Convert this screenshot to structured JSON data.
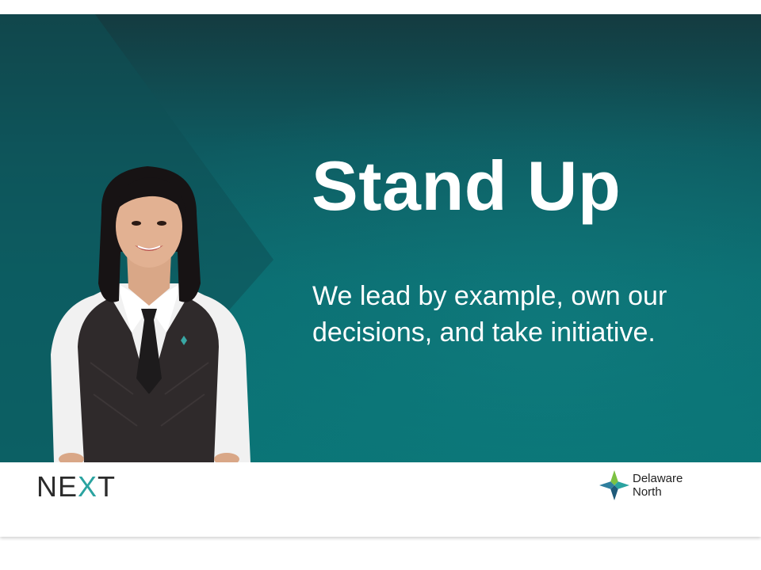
{
  "slide": {
    "title": "Stand Up",
    "body": "We lead by example, own our decisions, and take initiative."
  },
  "footer": {
    "left_logo": {
      "part1": "NE",
      "accent": "X",
      "part2": "T"
    },
    "right_logo": {
      "line1": "Delaware",
      "line2": "North"
    }
  },
  "colors": {
    "banner_top": "#143b40",
    "banner_bottom": "#0a7375",
    "title_text": "#ffffff",
    "logo_accent_teal": "#2aa3a0",
    "logo_accent_green": "#7cc142",
    "logo_dark": "#1e5a7a"
  }
}
